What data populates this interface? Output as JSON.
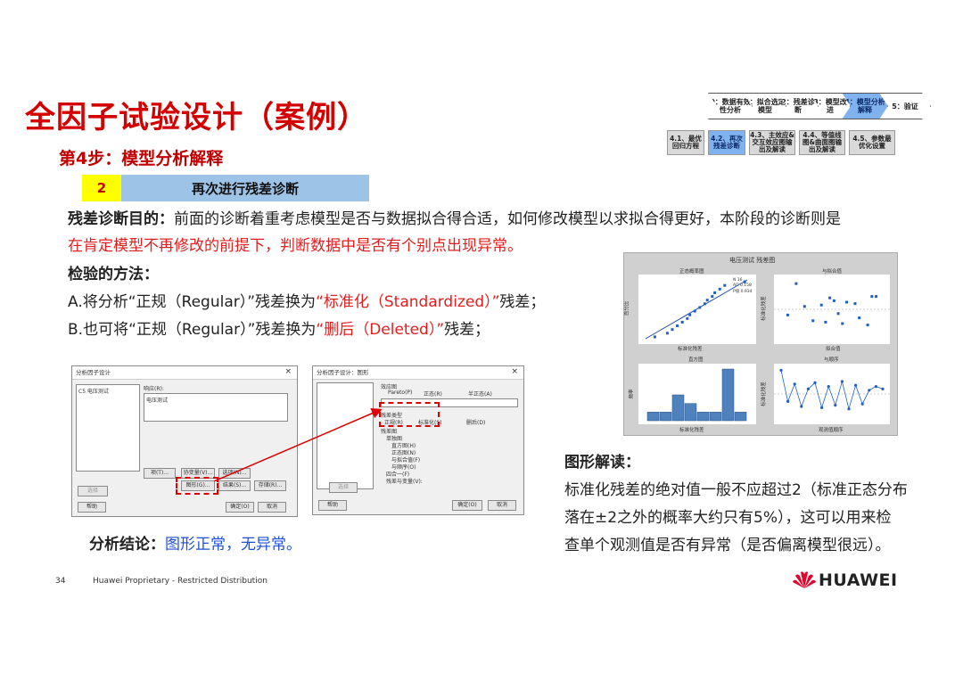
{
  "title": "全因子试验设计（案例）",
  "step": "第4步：模型分析解释",
  "badge": {
    "number": "2",
    "text": "再次进行残差诊断"
  },
  "purpose": {
    "label": "残差诊断目的：",
    "text1": "前面的诊断着重考虑模型是否与数据拟合得合适，如何修改模型以求拟合得更好，本阶段的诊断则是",
    "text2": "在肯定模型不再修改的前提下，判断数据中是否有个别点出现异常。"
  },
  "method": {
    "label": "检验的方法：",
    "a_pre": "A.将分析“正规（Regular）”残差换为",
    "a_hl": "“标准化（Standardized）”",
    "a_post": "残差；",
    "b_pre": "B.也可将“正规（Regular）”残差换为",
    "b_hl": "“删后（Deleted）”",
    "b_post": "残差；"
  },
  "graph_reading": {
    "label": "图形解读：",
    "line1": "标准化残差的绝对值一般不应超过2（标准正态分布",
    "line2": "落在±2之外的概率大约只有5%），这可以用来检",
    "line3": "查单个观测值是否有异常（是否偏离模型很远）。"
  },
  "conclusion": {
    "label": "分析结论：",
    "text": "图形正常，无异常。"
  },
  "process": {
    "top": [
      "0：数据有效性分析",
      "1：拟合选定模型",
      "2：残差诊断",
      "3：模型改进",
      "4：模型分析解释",
      "5：验证"
    ],
    "bottom": [
      "4.1、最优回归方程",
      "4.2、再次残差诊断",
      "4.3、主效应&交互效应图输出及解读",
      "4.4、等值线图&曲面图输出及解读",
      "4.5、参数最优化设置"
    ]
  },
  "dialog1": {
    "title": "分析因子设计",
    "list_item": "C5   电压测试",
    "response_label": "响应(R):",
    "response_value": "电压测试",
    "buttons": [
      "项(T)...",
      "协变量(V)...",
      "选项(N)...",
      "图形(G)...",
      "结果(S)...",
      "存储(R)...",
      "帮助",
      "确定(O)",
      "取消"
    ],
    "select_btn": "选择"
  },
  "dialog2": {
    "title": "分析因子设计：图形",
    "effect_label": "效应图",
    "effect_opts": [
      "Pareto(P)",
      "正态(R)",
      "半正态(A)"
    ],
    "resid_type_label": "残差类型",
    "resid_opts": [
      "正规(R)",
      "标准化(S)",
      "删后(D)"
    ],
    "resid_plots_label": "残差图",
    "plot_opts": [
      "单独图",
      "直方图(H)",
      "正态图(N)",
      "与拟合值(F)",
      "与顺序(O)",
      "四合一(F)",
      "残差与变量(V):"
    ],
    "buttons": [
      "选择",
      "帮助",
      "确定(O)",
      "取消"
    ]
  },
  "plots": {
    "title": "电压测试 残差图",
    "panels": [
      "正态概率图",
      "与拟合值",
      "直方图",
      "与顺序"
    ],
    "xlabels": [
      "标准化残差",
      "拟合值",
      "标准化残差",
      "观测值顺序"
    ],
    "ylabels": [
      "百分比",
      "标准化残差",
      "频率",
      "标准化残差"
    ],
    "stats": [
      "N  16",
      "AD  0.158",
      "P值  0.934"
    ],
    "hist_counts": [
      1,
      1,
      3,
      2,
      1,
      1,
      6,
      1
    ],
    "order_values": [
      1.9,
      -0.6,
      0.8,
      -1.0,
      0.4,
      0.9,
      -1.1,
      0.6,
      -0.9,
      1.0,
      -1.2,
      0.7,
      -0.8,
      0.3,
      0.6,
      0.4
    ],
    "normal_points": [
      -1.7,
      -1.2,
      -1.0,
      -0.8,
      -0.6,
      -0.4,
      -0.3,
      -0.1,
      0.1,
      0.3,
      0.4,
      0.6,
      0.7,
      0.9,
      1.1,
      1.9
    ],
    "fit_points": [
      [
        122,
        -0.4
      ],
      [
        124,
        1.8
      ],
      [
        126,
        0.2
      ],
      [
        128,
        -0.8
      ],
      [
        130,
        0.3
      ],
      [
        131,
        -0.9
      ],
      [
        132,
        0.8
      ],
      [
        133,
        0.6
      ],
      [
        134,
        -0.3
      ],
      [
        135,
        -1.0
      ],
      [
        136,
        0.5
      ],
      [
        138,
        0.4
      ],
      [
        139,
        -0.6
      ],
      [
        142,
        0.9
      ],
      [
        143,
        0.9
      ],
      [
        141,
        -1.1
      ]
    ]
  },
  "footer": {
    "page": "34",
    "text": "Huawei Proprietary - Restricted Distribution",
    "brand": "HUAWEI"
  },
  "colors": {
    "title_red": "#d40000",
    "highlight_blue": "#1f4fd6",
    "badge_yellow": "#ffff00",
    "badge_blue": "#9dc3e6",
    "point_blue": "#1f5fc4"
  }
}
